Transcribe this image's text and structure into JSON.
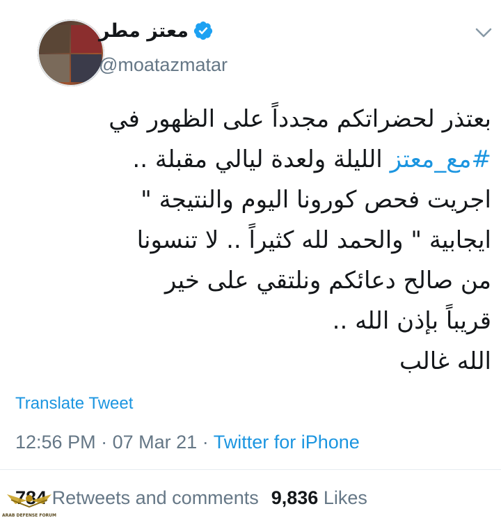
{
  "tweet": {
    "display_name": "معتز مطر",
    "handle": "@moatazmatar",
    "text_lines": [
      {
        "pre": "",
        "hashtag": "",
        "post": "بعتذر لحضراتكم مجدداً على الظهور في"
      },
      {
        "pre": "",
        "hashtag": "#مع_معتز",
        "post": " الليلة ولعدة ليالي مقبلة .."
      },
      {
        "pre": "",
        "hashtag": "",
        "post": "اجريت فحص كورونا اليوم والنتيجة \""
      },
      {
        "pre": "",
        "hashtag": "",
        "post": "ايجابية \" والحمد لله كثيراً .. لا تنسونا"
      },
      {
        "pre": "",
        "hashtag": "",
        "post": "من صالح دعائكم ونلتقي على خير"
      },
      {
        "pre": "",
        "hashtag": "",
        "post": "قريباً بإذن الله .."
      },
      {
        "pre": "",
        "hashtag": "",
        "post": "الله غالب"
      }
    ],
    "translate_label": "Translate Tweet",
    "time": "12:56 PM",
    "date": "07 Mar 21",
    "separator": "·",
    "source": "Twitter for iPhone",
    "retweets_count": "784",
    "retweets_label": "Retweets and comments",
    "likes_count": "9,836",
    "likes_label": "Likes"
  },
  "icons": {
    "verified": "verified-badge-icon",
    "menu": "chevron-down-icon"
  },
  "colors": {
    "link": "#1b95e0",
    "muted": "#657786",
    "text": "#14171a",
    "verified": "#1da1f2"
  },
  "watermark": {
    "text": "ARAB DEFENSE FORUM"
  }
}
